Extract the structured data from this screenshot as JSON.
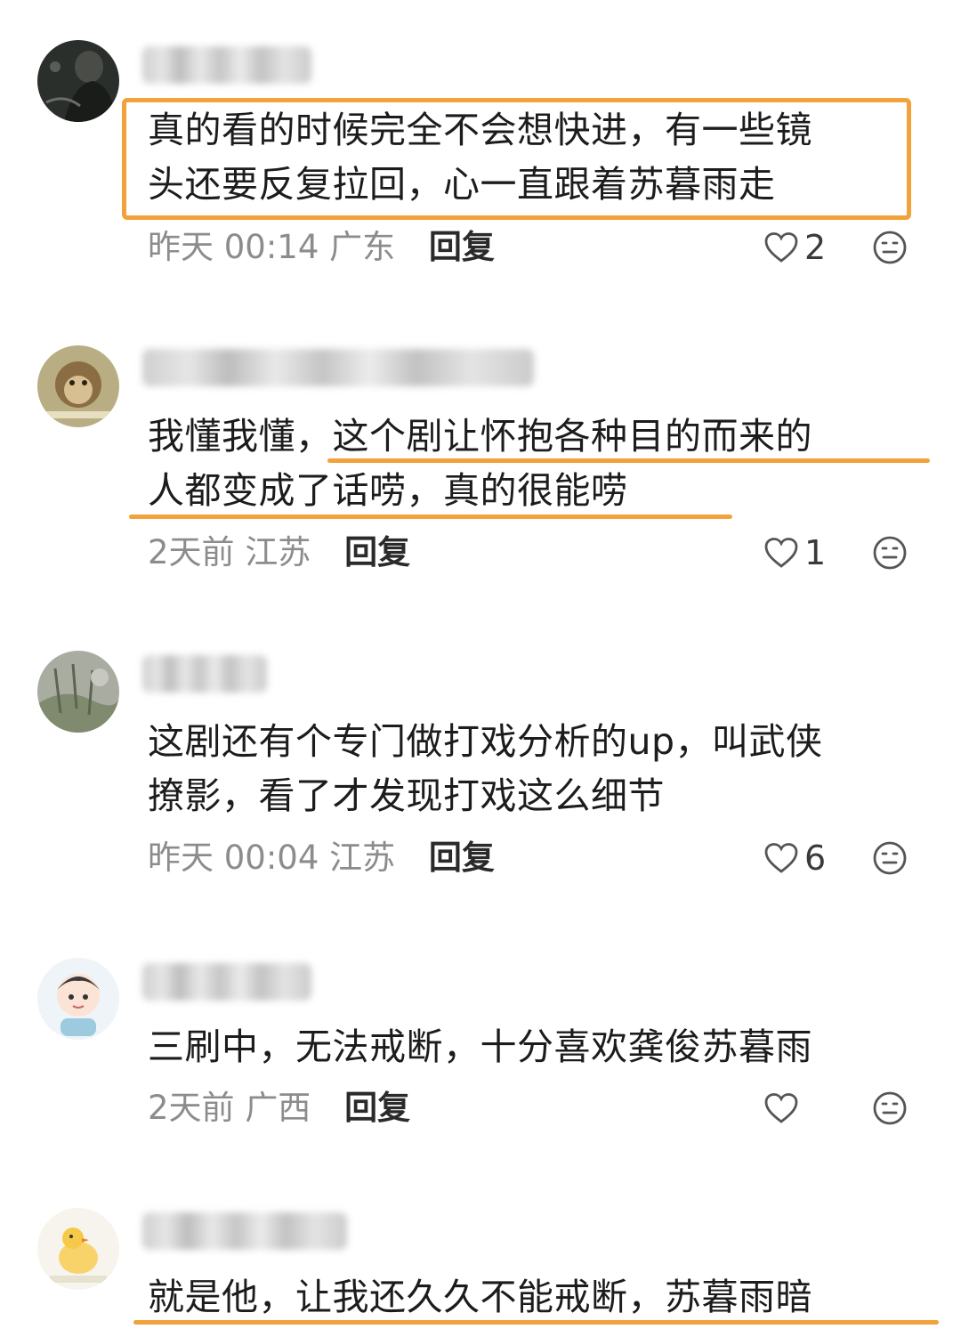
{
  "accent_color": "#f2a23a",
  "comments": [
    {
      "avatar_icon": "dark-figure-avatar",
      "lines": [
        "真的看的时候完全不会想快进，有一些镜",
        "头还要反复拉回，心一直跟着苏暮雨走"
      ],
      "time": "昨天 00:14",
      "region": "广东",
      "reply": "回复",
      "likes": "2"
    },
    {
      "avatar_icon": "monkey-avatar",
      "lines": [
        "我懂我懂，这个剧让怀抱各种目的而来的",
        "人都变成了话唠，真的很能唠"
      ],
      "time": "2天前",
      "region": "江苏",
      "reply": "回复",
      "likes": "1"
    },
    {
      "avatar_icon": "landscape-avatar",
      "lines": [
        "这剧还有个专门做打戏分析的up，叫武侠",
        "撩影，看了才发现打戏这么细节"
      ],
      "time": "昨天 00:04",
      "region": "江苏",
      "reply": "回复",
      "likes": "6"
    },
    {
      "avatar_icon": "cartoon-kid-avatar",
      "lines": [
        "三刷中，无法戒断，十分喜欢龚俊苏暮雨"
      ],
      "time": "2天前",
      "region": "广西",
      "reply": "回复",
      "likes": ""
    },
    {
      "avatar_icon": "chick-avatar",
      "lines": [
        "就是他，让我还久久不能戒断，苏暮雨暗"
      ]
    }
  ]
}
